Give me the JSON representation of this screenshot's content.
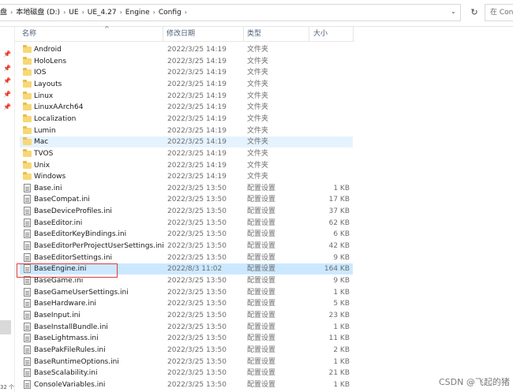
{
  "address_bar": {
    "breadcrumbs": [
      "盘",
      "本地磁盘 (D:)",
      "UE",
      "UE_4.27",
      "Engine",
      "Config"
    ],
    "separator": "›",
    "dropdown_glyph": "⌄",
    "refresh_glyph": "↻",
    "search_placeholder": "在 Config"
  },
  "columns": {
    "name": "名称",
    "date": "修改日期",
    "type": "类型",
    "size": "大小",
    "sort_glyph": "^"
  },
  "nav_pins": [
    "📌",
    "📌",
    "📌",
    "📌",
    "📌"
  ],
  "files": [
    {
      "name": "Android",
      "date": "2022/3/25 14:19",
      "type": "文件夹",
      "size": "",
      "kind": "folder"
    },
    {
      "name": "HoloLens",
      "date": "2022/3/25 14:19",
      "type": "文件夹",
      "size": "",
      "kind": "folder"
    },
    {
      "name": "IOS",
      "date": "2022/3/25 14:19",
      "type": "文件夹",
      "size": "",
      "kind": "folder"
    },
    {
      "name": "Layouts",
      "date": "2022/3/25 14:19",
      "type": "文件夹",
      "size": "",
      "kind": "folder"
    },
    {
      "name": "Linux",
      "date": "2022/3/25 14:19",
      "type": "文件夹",
      "size": "",
      "kind": "folder"
    },
    {
      "name": "LinuxAArch64",
      "date": "2022/3/25 14:19",
      "type": "文件夹",
      "size": "",
      "kind": "folder"
    },
    {
      "name": "Localization",
      "date": "2022/3/25 14:19",
      "type": "文件夹",
      "size": "",
      "kind": "folder"
    },
    {
      "name": "Lumin",
      "date": "2022/3/25 14:19",
      "type": "文件夹",
      "size": "",
      "kind": "folder"
    },
    {
      "name": "Mac",
      "date": "2022/3/25 14:19",
      "type": "文件夹",
      "size": "",
      "kind": "folder",
      "state": "hover"
    },
    {
      "name": "TVOS",
      "date": "2022/3/25 14:19",
      "type": "文件夹",
      "size": "",
      "kind": "folder"
    },
    {
      "name": "Unix",
      "date": "2022/3/25 14:19",
      "type": "文件夹",
      "size": "",
      "kind": "folder"
    },
    {
      "name": "Windows",
      "date": "2022/3/25 14:19",
      "type": "文件夹",
      "size": "",
      "kind": "folder"
    },
    {
      "name": "Base.ini",
      "date": "2022/3/25 13:50",
      "type": "配置设置",
      "size": "1 KB",
      "kind": "file"
    },
    {
      "name": "BaseCompat.ini",
      "date": "2022/3/25 13:50",
      "type": "配置设置",
      "size": "17 KB",
      "kind": "file"
    },
    {
      "name": "BaseDeviceProfiles.ini",
      "date": "2022/3/25 13:50",
      "type": "配置设置",
      "size": "37 KB",
      "kind": "file"
    },
    {
      "name": "BaseEditor.ini",
      "date": "2022/3/25 13:50",
      "type": "配置设置",
      "size": "62 KB",
      "kind": "file"
    },
    {
      "name": "BaseEditorKeyBindings.ini",
      "date": "2022/3/25 13:50",
      "type": "配置设置",
      "size": "6 KB",
      "kind": "file"
    },
    {
      "name": "BaseEditorPerProjectUserSettings.ini",
      "date": "2022/3/25 13:50",
      "type": "配置设置",
      "size": "42 KB",
      "kind": "file"
    },
    {
      "name": "BaseEditorSettings.ini",
      "date": "2022/3/25 13:50",
      "type": "配置设置",
      "size": "9 KB",
      "kind": "file"
    },
    {
      "name": "BaseEngine.ini",
      "date": "2022/8/3 11:02",
      "type": "配置设置",
      "size": "164 KB",
      "kind": "file",
      "state": "selected"
    },
    {
      "name": "BaseGame.ini",
      "date": "2022/3/25 13:50",
      "type": "配置设置",
      "size": "9 KB",
      "kind": "file"
    },
    {
      "name": "BaseGameUserSettings.ini",
      "date": "2022/3/25 13:50",
      "type": "配置设置",
      "size": "1 KB",
      "kind": "file"
    },
    {
      "name": "BaseHardware.ini",
      "date": "2022/3/25 13:50",
      "type": "配置设置",
      "size": "5 KB",
      "kind": "file"
    },
    {
      "name": "BaseInput.ini",
      "date": "2022/3/25 13:50",
      "type": "配置设置",
      "size": "23 KB",
      "kind": "file"
    },
    {
      "name": "BaseInstallBundle.ini",
      "date": "2022/3/25 13:50",
      "type": "配置设置",
      "size": "1 KB",
      "kind": "file"
    },
    {
      "name": "BaseLightmass.ini",
      "date": "2022/3/25 13:50",
      "type": "配置设置",
      "size": "11 KB",
      "kind": "file"
    },
    {
      "name": "BasePakFileRules.ini",
      "date": "2022/3/25 13:50",
      "type": "配置设置",
      "size": "2 KB",
      "kind": "file"
    },
    {
      "name": "BaseRuntimeOptions.ini",
      "date": "2022/3/25 13:50",
      "type": "配置设置",
      "size": "1 KB",
      "kind": "file"
    },
    {
      "name": "BaseScalability.ini",
      "date": "2022/3/25 13:50",
      "type": "配置设置",
      "size": "21 KB",
      "kind": "file"
    },
    {
      "name": "ConsoleVariables.ini",
      "date": "2022/3/25 13:50",
      "type": "配置设置",
      "size": "1 KB",
      "kind": "file"
    }
  ],
  "status_text": "32 个",
  "watermark": "CSDN @飞起的猪",
  "colors": {
    "selected": "#cce8ff",
    "hover": "#e5f3ff",
    "highlight_box": "#e03b3b",
    "folder": "#f8d775"
  }
}
